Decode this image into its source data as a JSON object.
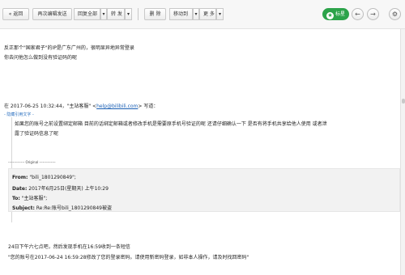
{
  "toolbar": {
    "back": "« 返回",
    "resend": "再次编辑发送",
    "reply_all": "回复全部",
    "reply_all_arrow": "▾",
    "forward": "转 发",
    "forward_arrow": "▾",
    "delete": "删 除",
    "move_to": "移动到",
    "move_to_arrow": "▾",
    "more": "更 多",
    "more_arrow": "▾",
    "star_label": "标星",
    "prev": "←",
    "next": "→",
    "settings": "⚙"
  },
  "body": {
    "line1": "反正那个\"国家君子\"的IP是广东广州的，很明显异地异常登录",
    "line2": "你去问他怎么做到没有验证码的呢",
    "quote_header_prefix": "在 2017-06-25 10:32:44，\"主站客服\" <",
    "quote_email": "help@bilibili.com",
    "quote_header_suffix": "> 写道：",
    "hide_quote": "- 隐藏引用文字 -",
    "quote_line1": "如果您的账号之前设置绑定邮箱 目前的话绑定邮箱或者修改手机是需要原手机号验证的呢 还请仔细确认一下 是否有将手机共享给他人使用 或者泄",
    "quote_line2": "露了验证码信息了呢",
    "original_divider": "-------------- Original --------------",
    "original": {
      "from_label": "From:",
      "from_value": "\"bili_1801290849\";",
      "date_label": "Date:",
      "date_value": "2017年6月25日(星期天) 上午10:29",
      "to_label": "To:",
      "to_value": "\"主站客服\";",
      "subject_label": "Subject:",
      "subject_value": "Re:Re:账号bili_1801290849被盗"
    },
    "line3": "24日下午六七点吧，然后发现手机在16:59收到一条短信",
    "line4": "\"您的账号在2017-06-24 16:59:28修改了您的登录密码。请使用新密码登录，如非本人操作，请及时找回密码\""
  },
  "colors": {
    "star_button": "#2ca34a",
    "link": "#1a5fb4"
  }
}
